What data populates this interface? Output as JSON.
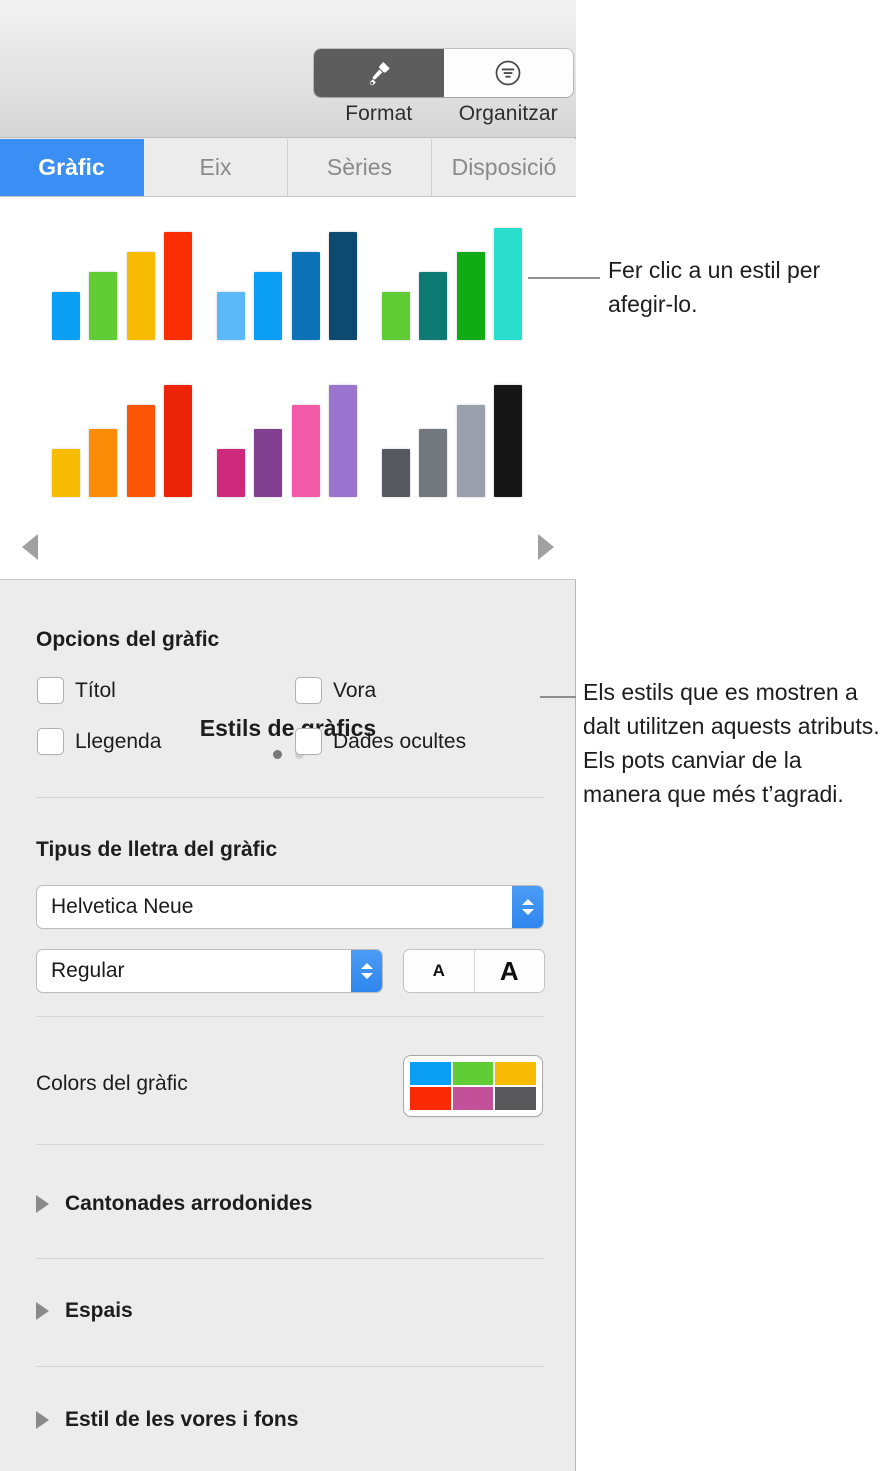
{
  "toolbar": {
    "segments": [
      {
        "label": "Format",
        "icon": "paintbrush-icon",
        "active": true
      },
      {
        "label": "Organitzar",
        "icon": "align-icon",
        "active": false
      }
    ]
  },
  "tabs": [
    {
      "label": "Gràfic",
      "active": true
    },
    {
      "label": "Eix",
      "active": false
    },
    {
      "label": "Sèries",
      "active": false
    },
    {
      "label": "Disposició",
      "active": false
    }
  ],
  "gallery": {
    "title": "Estils de gràfics",
    "prev_arrow": "previous-styles-arrow",
    "next_arrow": "next-styles-arrow",
    "page_dots": [
      true,
      false
    ],
    "accent_blue": "#3b8ef3",
    "styles": [
      {
        "name": "style-multicolor",
        "colors": [
          "#0a9ff5",
          "#5fcd33",
          "#f8bc05",
          "#f92d04"
        ],
        "heights": [
          48,
          68,
          88,
          108
        ]
      },
      {
        "name": "style-blues",
        "colors": [
          "#5bb8f7",
          "#0a9ff5",
          "#0b72b8",
          "#0c4a72"
        ],
        "heights": [
          48,
          68,
          88,
          108
        ]
      },
      {
        "name": "style-greens",
        "colors": [
          "#5fcd33",
          "#0f7a73",
          "#11ab14",
          "#2adecd"
        ],
        "heights": [
          48,
          68,
          88,
          112
        ]
      },
      {
        "name": "style-warm",
        "colors": [
          "#f8bc05",
          "#fa8c07",
          "#fb5505",
          "#ec2409"
        ],
        "heights": [
          48,
          68,
          92,
          112
        ]
      },
      {
        "name": "style-magenta-purple",
        "colors": [
          "#cd2a7e",
          "#80408f",
          "#f25aa8",
          "#9b74d0"
        ],
        "heights": [
          48,
          68,
          92,
          112
        ]
      },
      {
        "name": "style-grays",
        "colors": [
          "#55585f",
          "#73777e",
          "#99a0ab",
          "#161616"
        ],
        "heights": [
          48,
          68,
          92,
          112
        ]
      }
    ]
  },
  "chart_options": {
    "heading": "Opcions del gràfic",
    "checkboxes": [
      {
        "label": "Títol",
        "checked": false
      },
      {
        "label": "Vora",
        "checked": false
      },
      {
        "label": "Llegenda",
        "checked": false
      },
      {
        "label": "Dades ocultes",
        "checked": false
      }
    ]
  },
  "chart_font": {
    "heading": "Tipus de lletra del gràfic",
    "family_value": "Helvetica Neue",
    "style_value": "Regular",
    "size_small_label": "A",
    "size_large_label": "A"
  },
  "chart_colors": {
    "label": "Colors del gràfic",
    "swatches": [
      "#0a9ff5",
      "#5fcd33",
      "#f8bc05",
      "#fa2a06",
      "#c3519a",
      "#58585a"
    ]
  },
  "disclosures": [
    {
      "label": "Cantonades arrodonides",
      "expanded": false
    },
    {
      "label": "Espais",
      "expanded": false
    },
    {
      "label": "Estil de les vores i fons",
      "expanded": false
    }
  ],
  "callouts": [
    {
      "text": "Fer clic a un estil per afegir-lo."
    },
    {
      "text": "Els estils que es mostren a dalt utilitzen aquests atributs. Els pots canviar de la manera que més t’agradi."
    }
  ]
}
